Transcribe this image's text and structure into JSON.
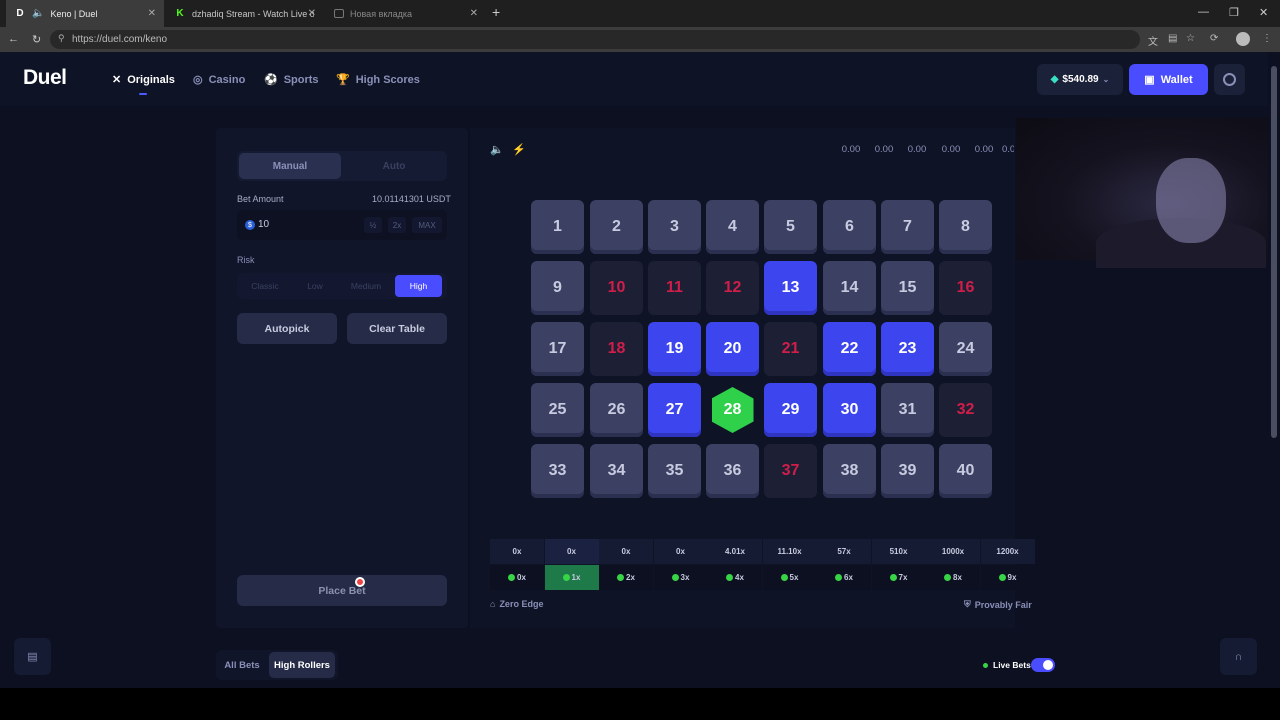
{
  "browser": {
    "tabs": [
      {
        "title": "Keno | Duel",
        "favicon": "D",
        "active": true
      },
      {
        "title": "dzhadiq Stream - Watch Live on Ki",
        "favicon": "K",
        "active": false
      },
      {
        "title": "Новая вкладка",
        "favicon": "",
        "active": false
      }
    ],
    "new_tab": "+",
    "url": "https://duel.com/keno"
  },
  "header": {
    "logo": "Duel",
    "nav": [
      {
        "label": "Originals",
        "icon": "crossed-swords-icon",
        "active": true
      },
      {
        "label": "Casino",
        "icon": "chip-icon",
        "active": false
      },
      {
        "label": "Sports",
        "icon": "ball-icon",
        "active": false
      },
      {
        "label": "High Scores",
        "icon": "trophy-icon",
        "active": false
      }
    ],
    "balance": "$540.89",
    "wallet_label": "Wallet"
  },
  "controls": {
    "mode_manual": "Manual",
    "mode_auto": "Auto",
    "bet_amount_label": "Bet Amount",
    "bet_amount_usdt": "10.01141301 USDT",
    "bet_value": "10",
    "half": "½",
    "double": "2x",
    "max": "MAX",
    "risk_label": "Risk",
    "risk_options": [
      "Classic",
      "Low",
      "Medium",
      "High"
    ],
    "risk_selected": "High",
    "autopick": "Autopick",
    "clear_table": "Clear Table",
    "place_bet": "Place Bet"
  },
  "game": {
    "last_results": [
      "0.00",
      "0.00",
      "0.00",
      "0.00",
      "0.00",
      "0.0"
    ],
    "tiles": [
      {
        "n": "1",
        "s": "normal"
      },
      {
        "n": "2",
        "s": "normal"
      },
      {
        "n": "3",
        "s": "normal"
      },
      {
        "n": "4",
        "s": "normal"
      },
      {
        "n": "5",
        "s": "normal"
      },
      {
        "n": "6",
        "s": "normal"
      },
      {
        "n": "7",
        "s": "normal"
      },
      {
        "n": "8",
        "s": "normal"
      },
      {
        "n": "9",
        "s": "normal"
      },
      {
        "n": "10",
        "s": "miss"
      },
      {
        "n": "11",
        "s": "miss"
      },
      {
        "n": "12",
        "s": "miss"
      },
      {
        "n": "13",
        "s": "picked"
      },
      {
        "n": "14",
        "s": "normal"
      },
      {
        "n": "15",
        "s": "normal"
      },
      {
        "n": "16",
        "s": "miss"
      },
      {
        "n": "17",
        "s": "normal"
      },
      {
        "n": "18",
        "s": "miss"
      },
      {
        "n": "19",
        "s": "picked"
      },
      {
        "n": "20",
        "s": "picked"
      },
      {
        "n": "21",
        "s": "miss"
      },
      {
        "n": "22",
        "s": "picked"
      },
      {
        "n": "23",
        "s": "picked"
      },
      {
        "n": "24",
        "s": "normal"
      },
      {
        "n": "25",
        "s": "normal"
      },
      {
        "n": "26",
        "s": "normal"
      },
      {
        "n": "27",
        "s": "picked"
      },
      {
        "n": "28",
        "s": "hit"
      },
      {
        "n": "29",
        "s": "picked"
      },
      {
        "n": "30",
        "s": "picked"
      },
      {
        "n": "31",
        "s": "normal"
      },
      {
        "n": "32",
        "s": "miss"
      },
      {
        "n": "33",
        "s": "normal"
      },
      {
        "n": "34",
        "s": "normal"
      },
      {
        "n": "35",
        "s": "normal"
      },
      {
        "n": "36",
        "s": "normal"
      },
      {
        "n": "37",
        "s": "miss"
      },
      {
        "n": "38",
        "s": "normal"
      },
      {
        "n": "39",
        "s": "normal"
      },
      {
        "n": "40",
        "s": "normal"
      }
    ],
    "payouts": [
      {
        "mult": "0x",
        "hits": "0x"
      },
      {
        "mult": "0x",
        "hits": "1x",
        "selected": true
      },
      {
        "mult": "0x",
        "hits": "2x"
      },
      {
        "mult": "0x",
        "hits": "3x"
      },
      {
        "mult": "4.01x",
        "hits": "4x"
      },
      {
        "mult": "11.10x",
        "hits": "5x"
      },
      {
        "mult": "57x",
        "hits": "6x"
      },
      {
        "mult": "510x",
        "hits": "7x"
      },
      {
        "mult": "1000x",
        "hits": "8x"
      },
      {
        "mult": "1200x",
        "hits": "9x"
      }
    ],
    "zero_edge": "Zero Edge",
    "provably_fair": "Provably Fair"
  },
  "bets": {
    "all_bets": "All Bets",
    "high_rollers": "High Rollers",
    "live_bets": "Live Bets"
  },
  "colors": {
    "accent": "#4a4cff",
    "picked_tile": "#3d45ee",
    "miss_text": "#d01e4a",
    "gem": "#2fd14a"
  }
}
